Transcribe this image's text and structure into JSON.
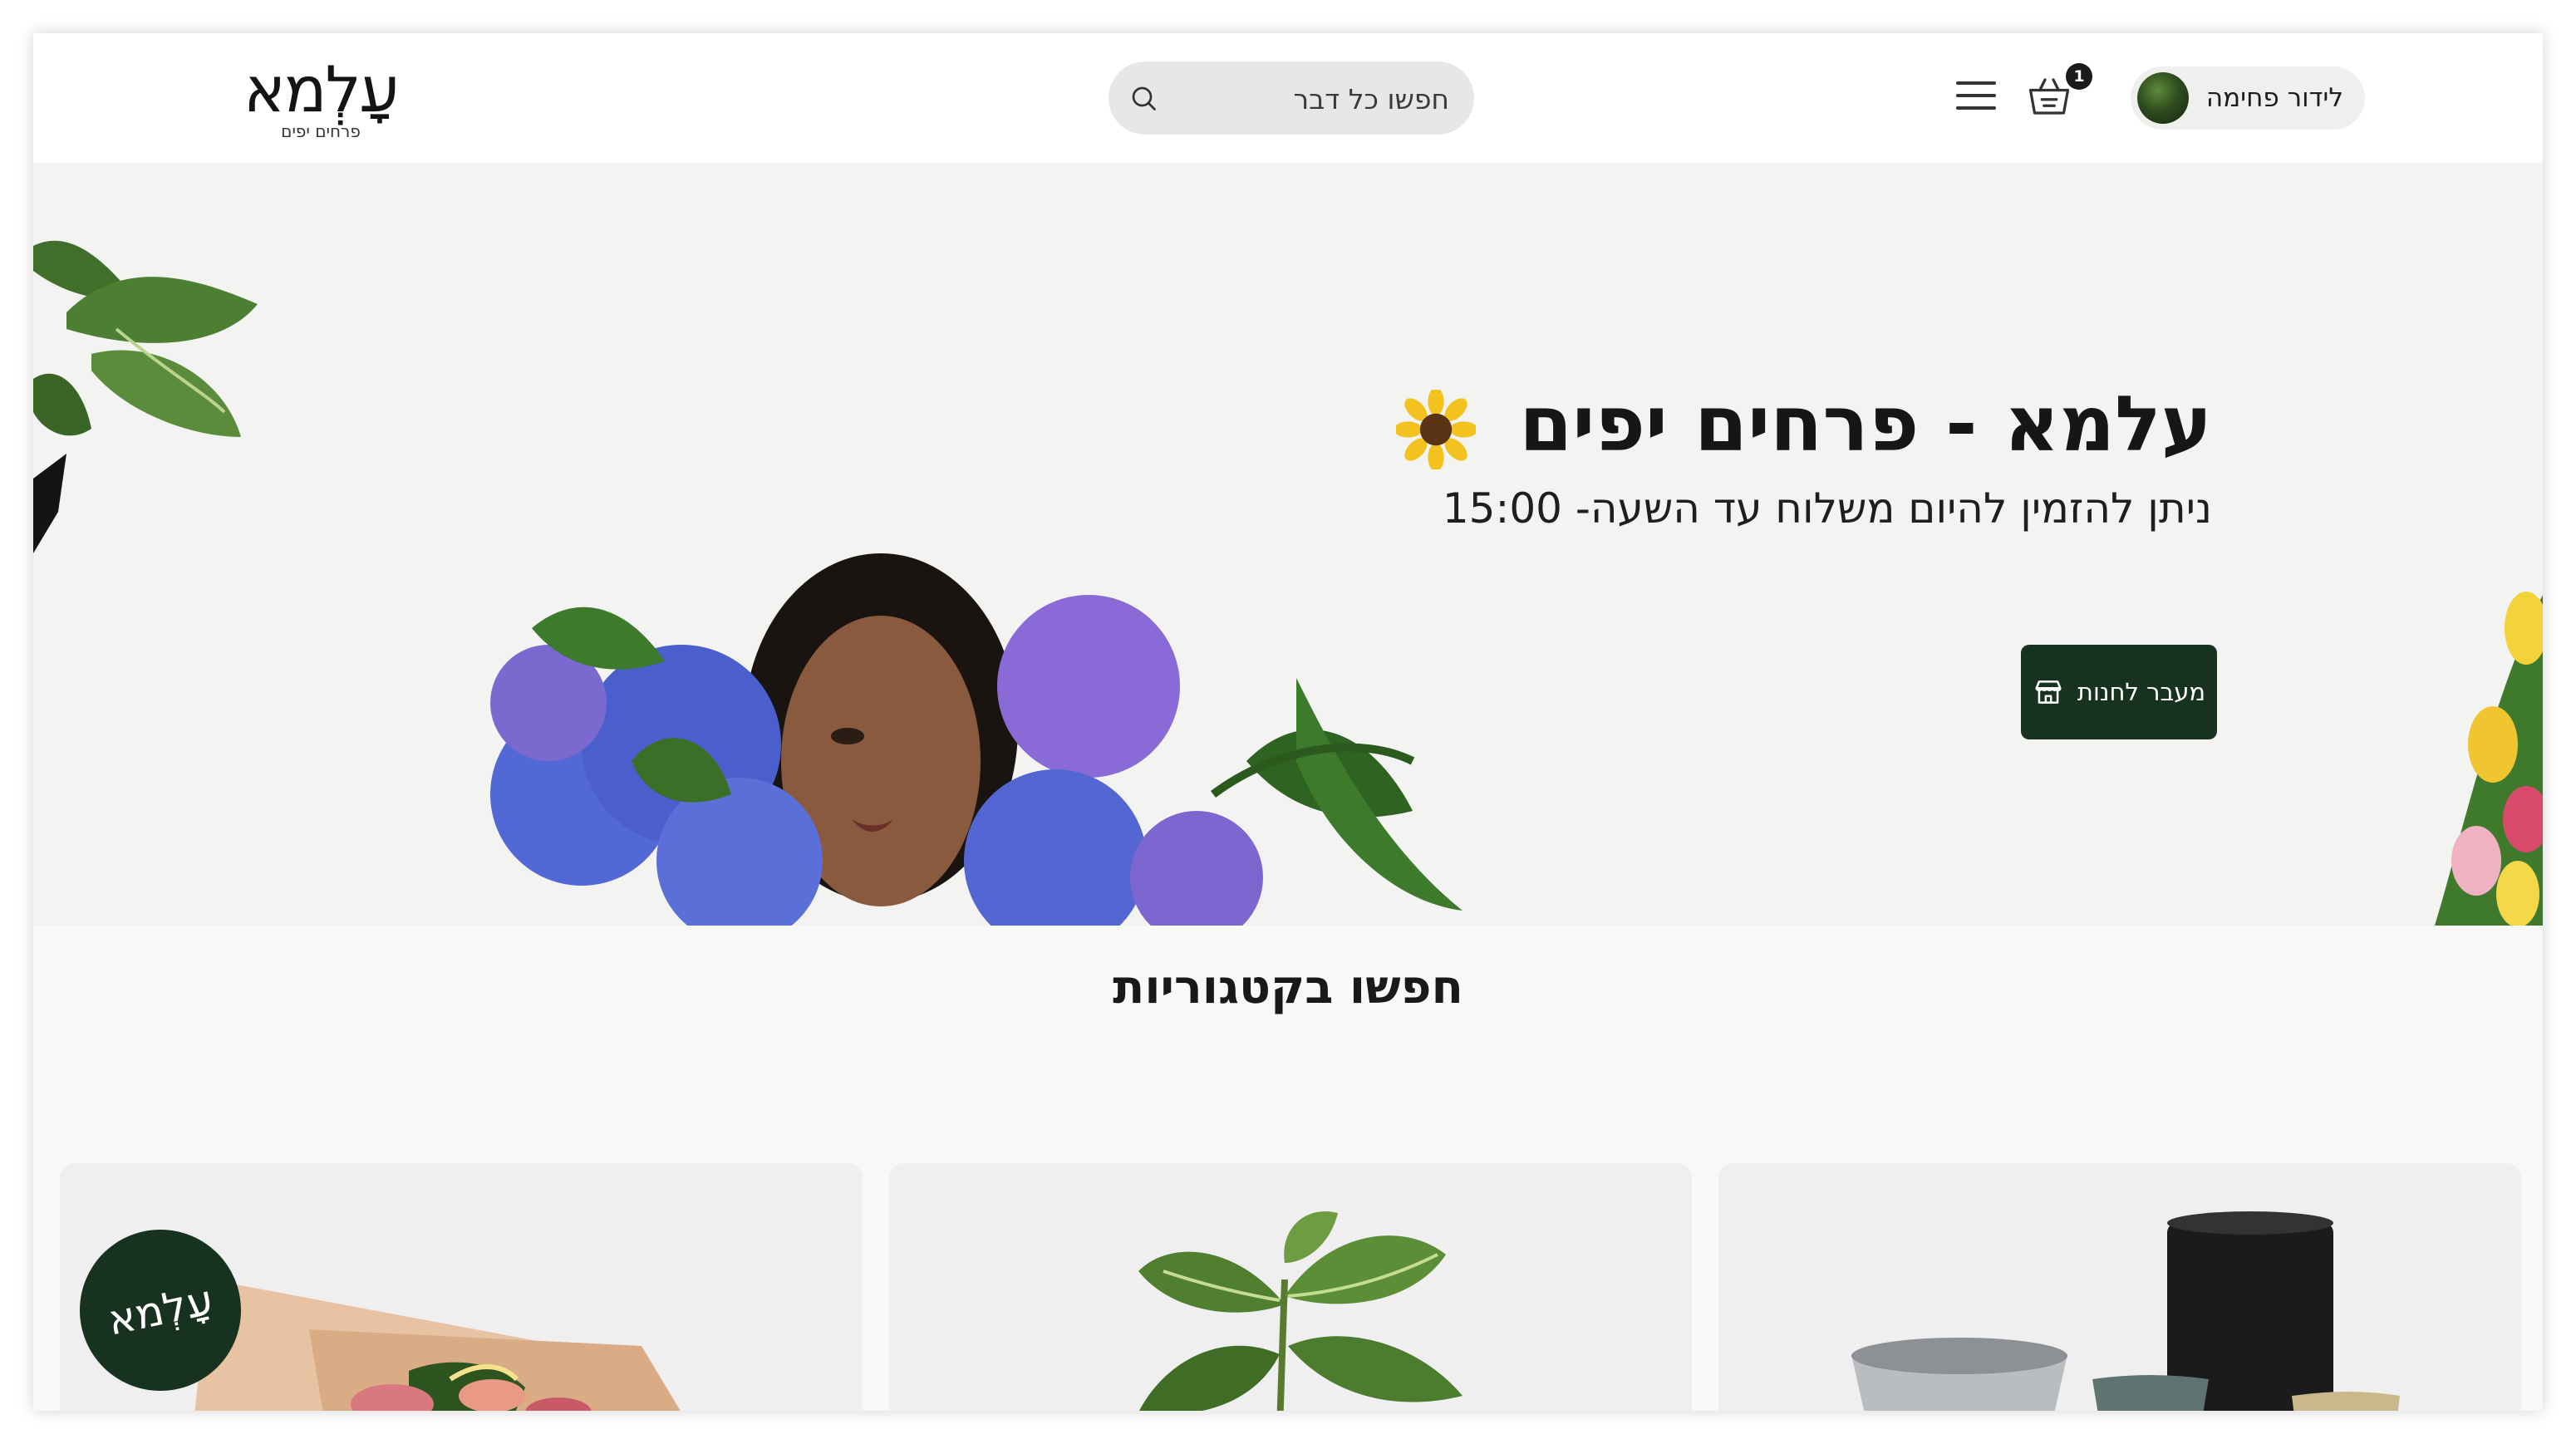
{
  "header": {
    "logo": {
      "word": "עָלְמא",
      "tagline": "פרחים יפים"
    },
    "search": {
      "placeholder": "חפשו כל דבר"
    },
    "cart": {
      "count": "1"
    },
    "account": {
      "name": "לידור פחימה"
    },
    "icons": [
      "search-icon",
      "menu-icon",
      "cart-icon"
    ]
  },
  "hero": {
    "title": "עלמא - פרחים יפים",
    "subtitle": "ניתן להזמין להיום משלוח עד השעה- 15:00",
    "cta_label": "מעבר לחנות",
    "icons": [
      "sunflower-emoji",
      "store-icon"
    ]
  },
  "categories": {
    "title": "חפשו בקטגוריות"
  },
  "badge": {
    "text": "עָלְמא"
  },
  "colors": {
    "brand_dark_green": "#17321f",
    "hero_background": "#f3f3f2",
    "page_background": "#f8f8f7"
  }
}
